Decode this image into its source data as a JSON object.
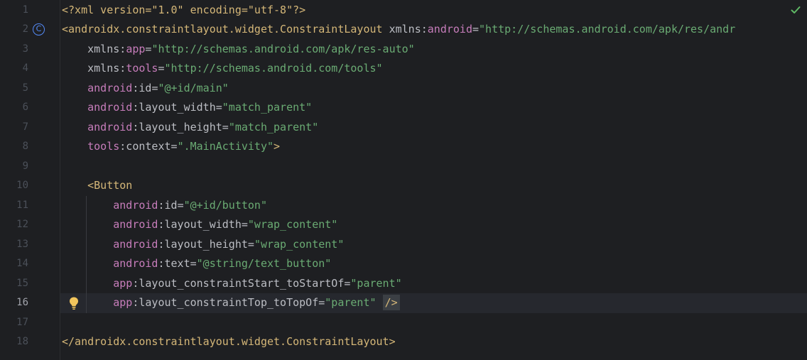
{
  "editor": {
    "current_line": 16,
    "line_numbers": [
      "1",
      "2",
      "3",
      "4",
      "5",
      "6",
      "7",
      "8",
      "9",
      "10",
      "11",
      "12",
      "13",
      "14",
      "15",
      "16",
      "17",
      "18"
    ],
    "icons": {
      "gutter_class_icon": "class-c-icon",
      "gutter_class_icon_glyph": "C",
      "gutter_intention_icon": "lightbulb-icon",
      "status_icon": "checkmark-icon"
    },
    "lines": [
      [
        {
          "c": "decl",
          "t": "<?xml version=\"1.0\" encoding=\"utf-8\"?>"
        }
      ],
      [
        {
          "c": "tag",
          "t": "<androidx.constraintlayout.widget.ConstraintLayout"
        },
        {
          "c": "attr",
          "t": " xmlns:"
        },
        {
          "c": "ns",
          "t": "android"
        },
        {
          "c": "punct",
          "t": "="
        },
        {
          "c": "str",
          "t": "\"http://schemas.android.com/apk/res/andr"
        }
      ],
      [
        {
          "c": "attr",
          "t": "    xmlns:"
        },
        {
          "c": "ns",
          "t": "app"
        },
        {
          "c": "punct",
          "t": "="
        },
        {
          "c": "str",
          "t": "\"http://schemas.android.com/apk/res-auto\""
        }
      ],
      [
        {
          "c": "attr",
          "t": "    xmlns:"
        },
        {
          "c": "ns",
          "t": "tools"
        },
        {
          "c": "punct",
          "t": "="
        },
        {
          "c": "str",
          "t": "\"http://schemas.android.com/tools\""
        }
      ],
      [
        {
          "c": "ns",
          "t": "    android"
        },
        {
          "c": "attr",
          "t": ":id"
        },
        {
          "c": "punct",
          "t": "="
        },
        {
          "c": "str",
          "t": "\"@+id/main\""
        }
      ],
      [
        {
          "c": "ns",
          "t": "    android"
        },
        {
          "c": "attr",
          "t": ":layout_width"
        },
        {
          "c": "punct",
          "t": "="
        },
        {
          "c": "str",
          "t": "\"match_parent\""
        }
      ],
      [
        {
          "c": "ns",
          "t": "    android"
        },
        {
          "c": "attr",
          "t": ":layout_height"
        },
        {
          "c": "punct",
          "t": "="
        },
        {
          "c": "str",
          "t": "\"match_parent\""
        }
      ],
      [
        {
          "c": "ns",
          "t": "    tools"
        },
        {
          "c": "attr",
          "t": ":context"
        },
        {
          "c": "punct",
          "t": "="
        },
        {
          "c": "str",
          "t": "\".MainActivity\""
        },
        {
          "c": "tag",
          "t": ">"
        }
      ],
      [],
      [
        {
          "c": "tag",
          "t": "    <Button"
        }
      ],
      [
        {
          "c": "ns",
          "t": "        android"
        },
        {
          "c": "attr",
          "t": ":id"
        },
        {
          "c": "punct",
          "t": "="
        },
        {
          "c": "str",
          "t": "\"@+id/button\""
        }
      ],
      [
        {
          "c": "ns",
          "t": "        android"
        },
        {
          "c": "attr",
          "t": ":layout_width"
        },
        {
          "c": "punct",
          "t": "="
        },
        {
          "c": "str",
          "t": "\"wrap_content\""
        }
      ],
      [
        {
          "c": "ns",
          "t": "        android"
        },
        {
          "c": "attr",
          "t": ":layout_height"
        },
        {
          "c": "punct",
          "t": "="
        },
        {
          "c": "str",
          "t": "\"wrap_content\""
        }
      ],
      [
        {
          "c": "ns",
          "t": "        android"
        },
        {
          "c": "attr",
          "t": ":text"
        },
        {
          "c": "punct",
          "t": "="
        },
        {
          "c": "str",
          "t": "\"@string/text_button\""
        }
      ],
      [
        {
          "c": "ns",
          "t": "        app"
        },
        {
          "c": "attr",
          "t": ":layout_constraintStart_toStartOf"
        },
        {
          "c": "punct",
          "t": "="
        },
        {
          "c": "str",
          "t": "\"parent\""
        }
      ],
      [
        {
          "c": "ns",
          "t": "        app"
        },
        {
          "c": "attr",
          "t": ":layout_constraintTop_toTopOf"
        },
        {
          "c": "punct",
          "t": "="
        },
        {
          "c": "str",
          "t": "\"parent\""
        },
        {
          "c": "punct",
          "t": " "
        },
        {
          "c": "selfclose",
          "t": "/>"
        }
      ],
      [],
      [
        {
          "c": "tag",
          "t": "</androidx.constraintlayout.widget.ConstraintLayout>"
        }
      ]
    ]
  },
  "colors": {
    "background": "#1e1f22",
    "tag": "#d5b778",
    "namespace": "#c77dbb",
    "string": "#6aab73",
    "text": "#bcbec4",
    "line_number": "#4b5059",
    "accent_blue": "#548af7",
    "check_green": "#5fb865",
    "bulb_yellow": "#f2c55c"
  }
}
